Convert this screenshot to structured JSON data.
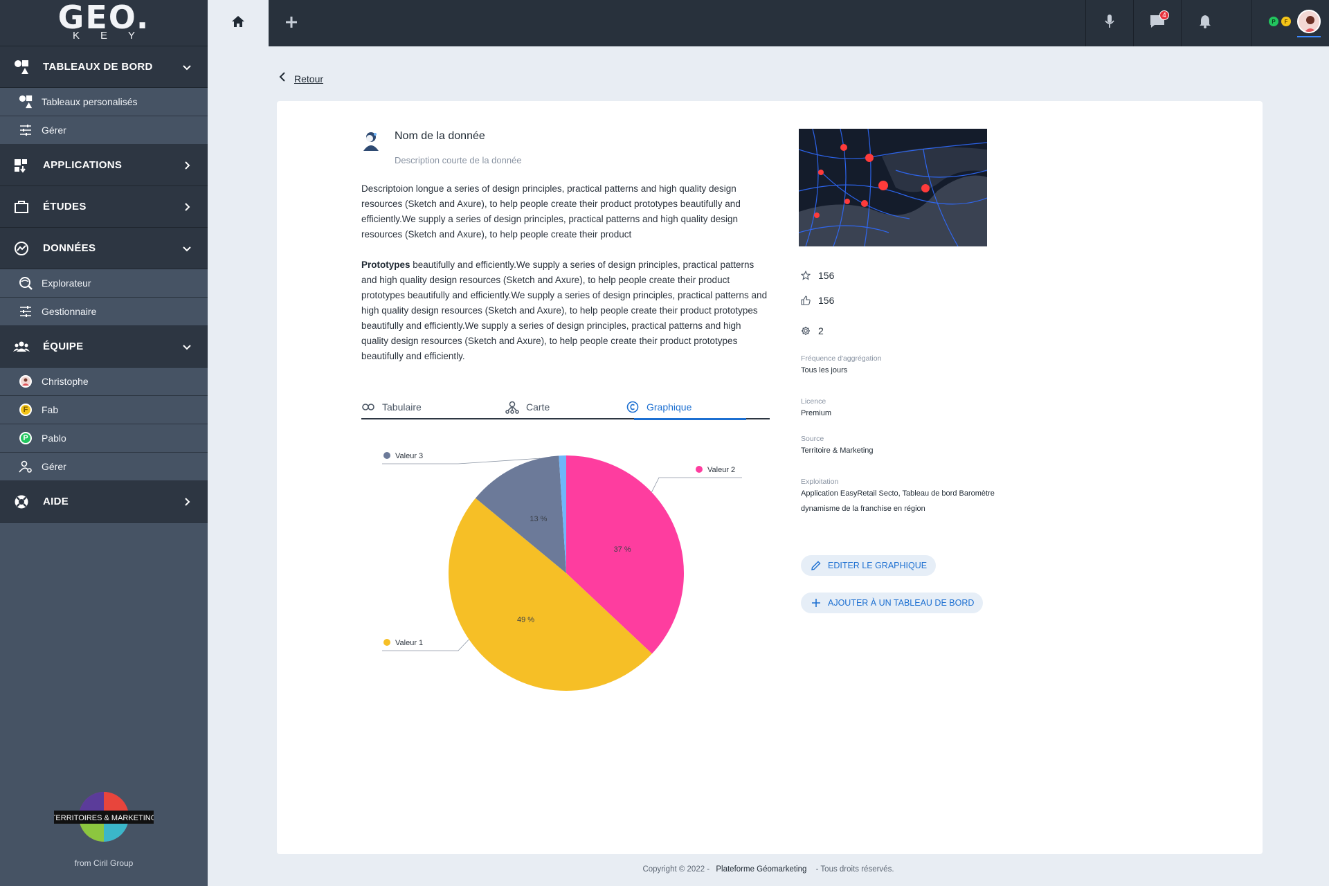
{
  "brand": {
    "logo_main": "GEO.",
    "logo_sub": "KEY",
    "partner_logo": "TERRITOIRES & MARKETING",
    "partner_from": "from Ciril Group"
  },
  "sidebar": {
    "sections": [
      {
        "label": "TABLEAUX DE BORD",
        "items": [
          {
            "label": "Tableaux personalisés"
          },
          {
            "label": "Gérer"
          }
        ]
      },
      {
        "label": "APPLICATIONS"
      },
      {
        "label": "ÉTUDES"
      },
      {
        "label": "DONNÉES",
        "items": [
          {
            "label": "Explorateur"
          },
          {
            "label": "Gestionnaire"
          }
        ]
      },
      {
        "label": "ÉQUIPE",
        "items": [
          {
            "label": "Christophe"
          },
          {
            "label": "Fab",
            "initial": "F"
          },
          {
            "label": "Pablo",
            "initial": "P"
          },
          {
            "label": "Gérer"
          }
        ]
      },
      {
        "label": "AIDE"
      }
    ]
  },
  "topbar": {
    "messages_badge": "4",
    "presence": [
      {
        "initial": "P",
        "color": "#22c55e"
      },
      {
        "initial": "F",
        "color": "#f5c518"
      }
    ]
  },
  "back": {
    "label": "Retour"
  },
  "dataset": {
    "title": "Nom de la donnée",
    "short_description": "Description courte de la donnée",
    "long_description": "Descriptoion longue a series of design principles, practical patterns and high quality design resources (Sketch and Axure), to help people create their product prototypes beautifully and efficiently.We supply a series of design principles, practical patterns and high quality design resources (Sketch and Axure), to help people create their product",
    "extra_bold": "Prototypes",
    "extra_rest": " beautifully and efficiently.We supply a series of design principles, practical patterns and high quality design resources (Sketch and Axure), to help people create their product prototypes beautifully and efficiently.We supply a series of design principles, practical patterns and high quality design resources (Sketch and Axure), to help people create their product prototypes beautifully and efficiently.We supply a series of design principles, practical patterns and high quality design resources (Sketch and Axure), to help people create their product prototypes beautifully and efficiently."
  },
  "tabs": [
    {
      "label": "Tabulaire"
    },
    {
      "label": "Carte"
    },
    {
      "label": "Graphique",
      "active": true
    }
  ],
  "chart_data": {
    "type": "pie",
    "categories": [
      "Valeur 2",
      "Valeur 1",
      "Valeur 3",
      ""
    ],
    "values": [
      37,
      49,
      13,
      1
    ],
    "slice_labels": [
      "37 %",
      "49 %",
      "13 %",
      ""
    ],
    "colors": [
      "#fe3d9f",
      "#f6bf26",
      "#6c7a99",
      "#6fb6f9"
    ],
    "legend": [
      "Valeur 3",
      "Valeur 2",
      "Valeur 1"
    ]
  },
  "stats": {
    "favorites": "156",
    "likes": "156",
    "uses": "2"
  },
  "meta": [
    {
      "label": "Fréquence d'aggrégation",
      "value": "Tous les jours"
    },
    {
      "label": "Licence",
      "value": "Premium"
    },
    {
      "label": "Source",
      "value": "Territoire & Marketing"
    },
    {
      "label": "Exploitation",
      "value": "Application EasyRetail Secto, Tableau de bord Baromètre dynamisme de la franchise en région"
    }
  ],
  "actions": {
    "edit": "EDITER LE GRAPHIQUE",
    "add": "AJOUTER À UN TABLEAU DE BORD"
  },
  "footer": {
    "copyright": "Copyright © 2022 -",
    "platform": "Plateforme Géomarketing",
    "rights": "- Tous droits réservés."
  },
  "colors": {
    "accent": "#1c6fd1",
    "sidebar_dark": "#2d3642",
    "sidebar": "#465364",
    "topbar": "#28313c"
  }
}
